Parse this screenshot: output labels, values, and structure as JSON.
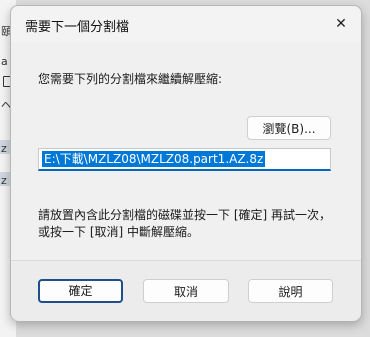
{
  "background": {
    "fragments": [
      "頤",
      "a",
      "ヘ",
      "z",
      "z"
    ]
  },
  "dialog": {
    "title": "需要下一個分割檔",
    "close_glyph": "✕",
    "prompt": "您需要下列的分割檔來繼續解壓縮:",
    "browse_label": "瀏覽(B)...",
    "path_value": "E:\\下載\\MZLZ08\\MZLZ08.part1.AZ.8z",
    "instruction_line1": "請放置內含此分割檔的磁碟並按一下 [確定] 再試一次，",
    "instruction_line2": "或按一下 [取消] 中斷解壓縮。",
    "buttons": {
      "ok": "確定",
      "cancel": "取消",
      "help": "說明"
    }
  }
}
